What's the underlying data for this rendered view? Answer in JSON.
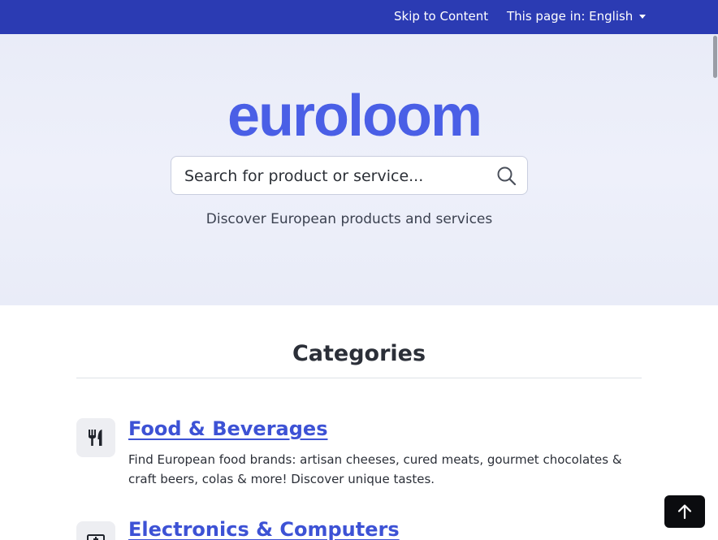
{
  "topbar": {
    "skip_label": "Skip to Content",
    "language_label": "This page in: English"
  },
  "hero": {
    "logo": "euroloom",
    "search_placeholder": "Search for product or service...",
    "tagline": "Discover European products and services"
  },
  "categories": {
    "title": "Categories",
    "items": [
      {
        "icon": "fork-knife-icon",
        "title": "Food & Beverages",
        "description": "Find European food brands: artisan cheeses, cured meats, gourmet chocolates & craft beers, colas & more! Discover unique tastes."
      },
      {
        "icon": "electronics-icon",
        "title": "Electronics & Computers",
        "description": ""
      }
    ]
  },
  "colors": {
    "topbar": "#2b3bb3",
    "brand": "#4a5fe6",
    "link": "#3d52d5"
  },
  "icons": {
    "search": "search-icon",
    "back_to_top": "arrow-up-icon"
  }
}
